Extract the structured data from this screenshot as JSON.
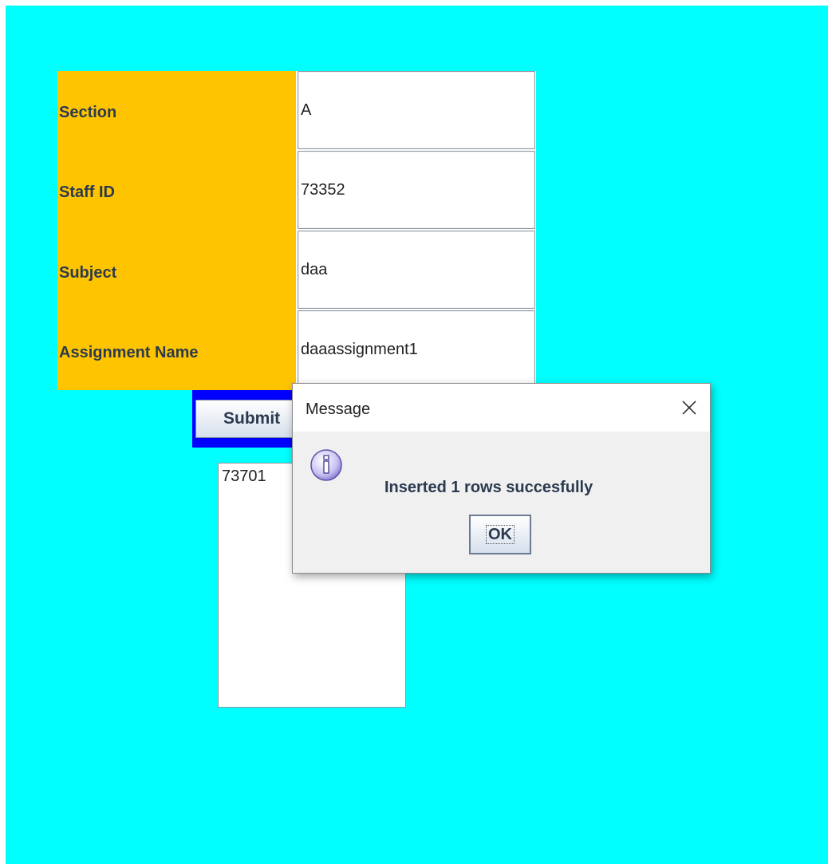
{
  "form": {
    "fields": [
      {
        "label": "Section",
        "value": "A"
      },
      {
        "label": "Staff ID",
        "value": "73352"
      },
      {
        "label": "Subject",
        "value": "daa"
      },
      {
        "label": "Assignment Name",
        "value": "daaassignment1"
      }
    ],
    "submit_label": "Submit",
    "result_text": "73701"
  },
  "dialog": {
    "title": "Message",
    "message": "Inserted 1 rows succesfully",
    "ok_label": "OK",
    "icon": "info-icon",
    "close_icon": "close-icon"
  },
  "colors": {
    "background": "#00ffff",
    "label_panel": "#ffc400",
    "submit_border": "#0000ff"
  }
}
